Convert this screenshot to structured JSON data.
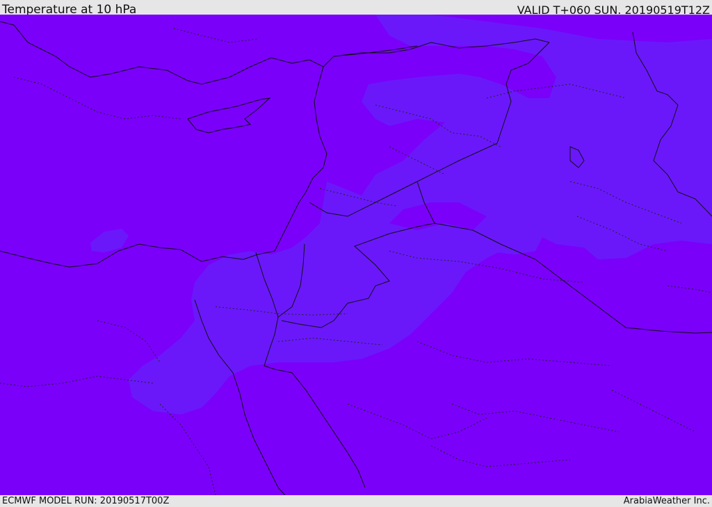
{
  "header": {
    "title": "Temperature at 10 hPa",
    "valid_time": "VALID T+060 SUN. 20190519T12Z"
  },
  "footer": {
    "model_run": "ECMWF MODEL RUN: 20190517T00Z",
    "credit": "ArabiaWeather Inc."
  },
  "map": {
    "field_colors": {
      "base": "#7a00fa",
      "warmer_band": "#6a18fa"
    },
    "line_colors": {
      "coastline": "#111111",
      "borders": "#111111"
    }
  }
}
